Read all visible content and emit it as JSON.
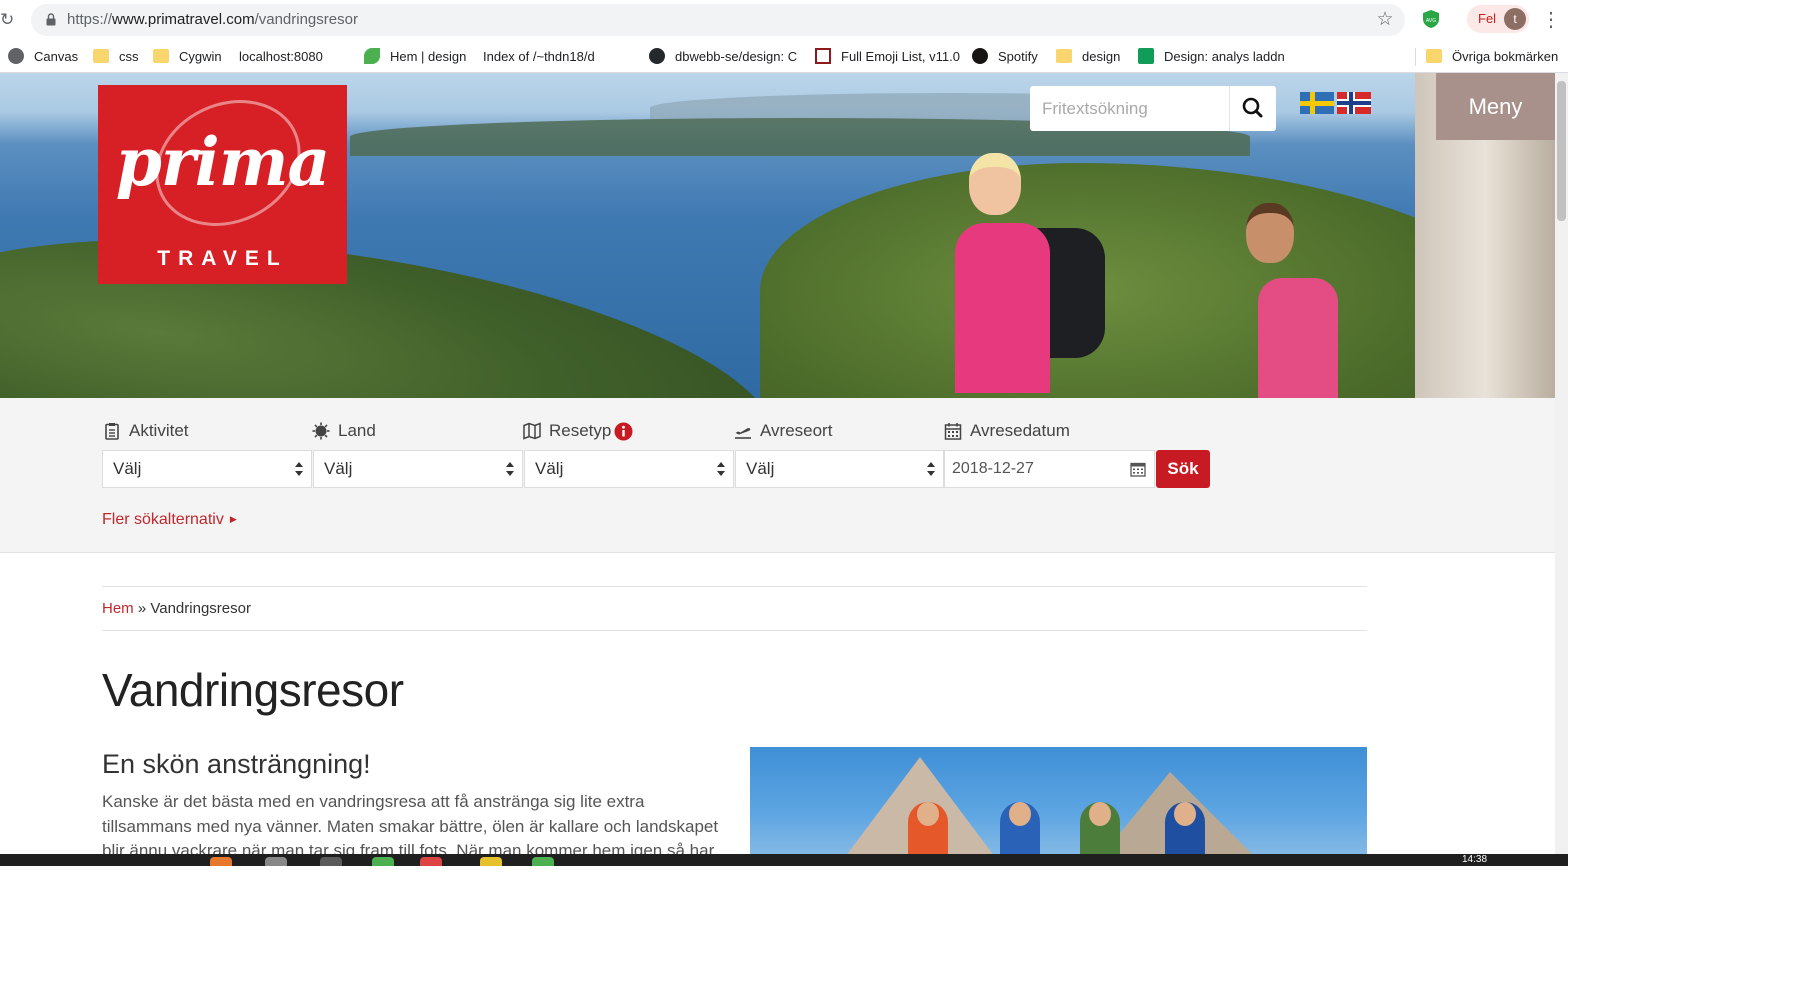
{
  "browser": {
    "url_scheme": "https://",
    "url_host": "www.primatravel.com",
    "url_path": "/vandringsresor",
    "profile_label": "Fel",
    "profile_initial": "t",
    "bookmarks": [
      {
        "label": "Canvas",
        "icon": "globe-icon"
      },
      {
        "label": "css",
        "icon": "folder-icon"
      },
      {
        "label": "Cygwin",
        "icon": "folder-icon"
      },
      {
        "label": "localhost:8080",
        "icon": "page-icon"
      },
      {
        "label": "Hem | design",
        "icon": "leaf-icon"
      },
      {
        "label": "Index of /~thdn18/d",
        "icon": "page-icon"
      },
      {
        "label": "dbwebb-se/design: C",
        "icon": "github-icon"
      },
      {
        "label": "Full Emoji List, v11.0",
        "icon": "unicode-icon"
      },
      {
        "label": "Spotify",
        "icon": "spotify-icon"
      },
      {
        "label": "design",
        "icon": "folder-icon"
      },
      {
        "label": "Design: analys laddn",
        "icon": "sheets-icon"
      }
    ],
    "other_bookmarks": "Övriga bokmärken"
  },
  "header": {
    "logo_word": "prima",
    "logo_sub": "TRAVEL",
    "search_placeholder": "Fritextsökning",
    "menu_label": "Meny"
  },
  "filters": {
    "aktivitet_label": "Aktivitet",
    "land_label": "Land",
    "resetyp_label": "Resetyp",
    "avreseort_label": "Avreseort",
    "avresedatum_label": "Avresedatum",
    "select_value": "Välj",
    "date_value": "2018-12-27",
    "search_button": "Sök",
    "more_options": "Fler sökalternativ"
  },
  "breadcrumb": {
    "home": "Hem",
    "separator": "»",
    "current": "Vandringsresor"
  },
  "content": {
    "title": "Vandringsresor",
    "subheading": "En skön ansträngning!",
    "intro": "Kanske är det bästa med en vandringsresa att få anstränga sig lite extra tillsammans med nya vänner. Maten smakar bättre, ölen är kallare och landskapet blir ännu vackrare när man tar sig fram till fots. När man kommer hem igen så har man"
  },
  "taskbar": {
    "clock": "14:38"
  },
  "colors": {
    "brand_red": "#d71f26",
    "button_red": "#c81a22",
    "link_red": "#c1272d",
    "menu_bg": "#a9918b",
    "filter_bg": "#f4f4f4"
  }
}
